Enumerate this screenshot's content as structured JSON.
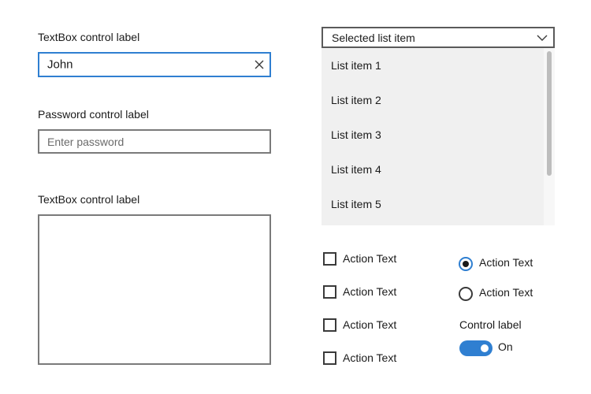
{
  "textbox": {
    "label": "TextBox control label",
    "value": "John"
  },
  "password": {
    "label": "Password control label",
    "placeholder": "Enter password"
  },
  "multiline": {
    "label": "TextBox control label"
  },
  "combo": {
    "selected": "Selected list item",
    "items": [
      "List item 1",
      "List item 2",
      "List item 3",
      "List item 4",
      "List item 5"
    ]
  },
  "checkboxes": [
    {
      "label": "Action Text",
      "checked": false
    },
    {
      "label": "Action Text",
      "checked": false
    },
    {
      "label": "Action Text",
      "checked": false
    },
    {
      "label": "Action Text",
      "checked": false
    }
  ],
  "radios": [
    {
      "label": "Action Text",
      "checked": true
    },
    {
      "label": "Action Text",
      "checked": false
    }
  ],
  "toggle": {
    "label": "Control label",
    "state_text": "On",
    "on": true
  },
  "colors": {
    "accent": "#2f7fd1",
    "border": "#7a7a7a",
    "dropdown_bg": "#f0f0f0"
  },
  "icons": {
    "clear": "clear-x-icon",
    "dropdown": "chevron-down-icon"
  }
}
